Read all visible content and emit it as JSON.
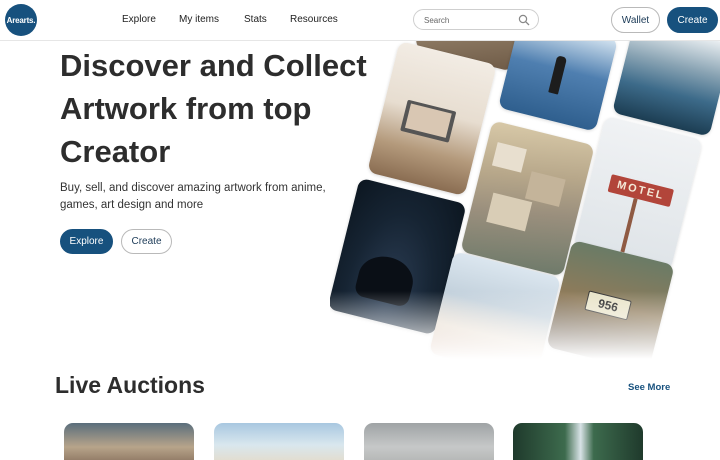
{
  "brand": {
    "logo_text": "Arearts."
  },
  "nav": {
    "links": [
      "Explore",
      "My items",
      "Stats",
      "Resources"
    ],
    "search_placeholder": "Search",
    "wallet_label": "Wallet",
    "create_label": "Create"
  },
  "hero": {
    "title": "Discover and Collect Artwork from top Creator",
    "subtitle": "Buy, sell, and discover amazing artwork from anime, games, art design and more",
    "explore_label": "Explore",
    "create_label": "Create",
    "motel_sign_text": "MOTEL",
    "license_plate_text": "956"
  },
  "auctions": {
    "title": "Live Auctions",
    "see_more_label": "See More"
  },
  "colors": {
    "primary": "#17517e",
    "text": "#2d2d2d"
  },
  "icons": {
    "search": "search-icon"
  }
}
